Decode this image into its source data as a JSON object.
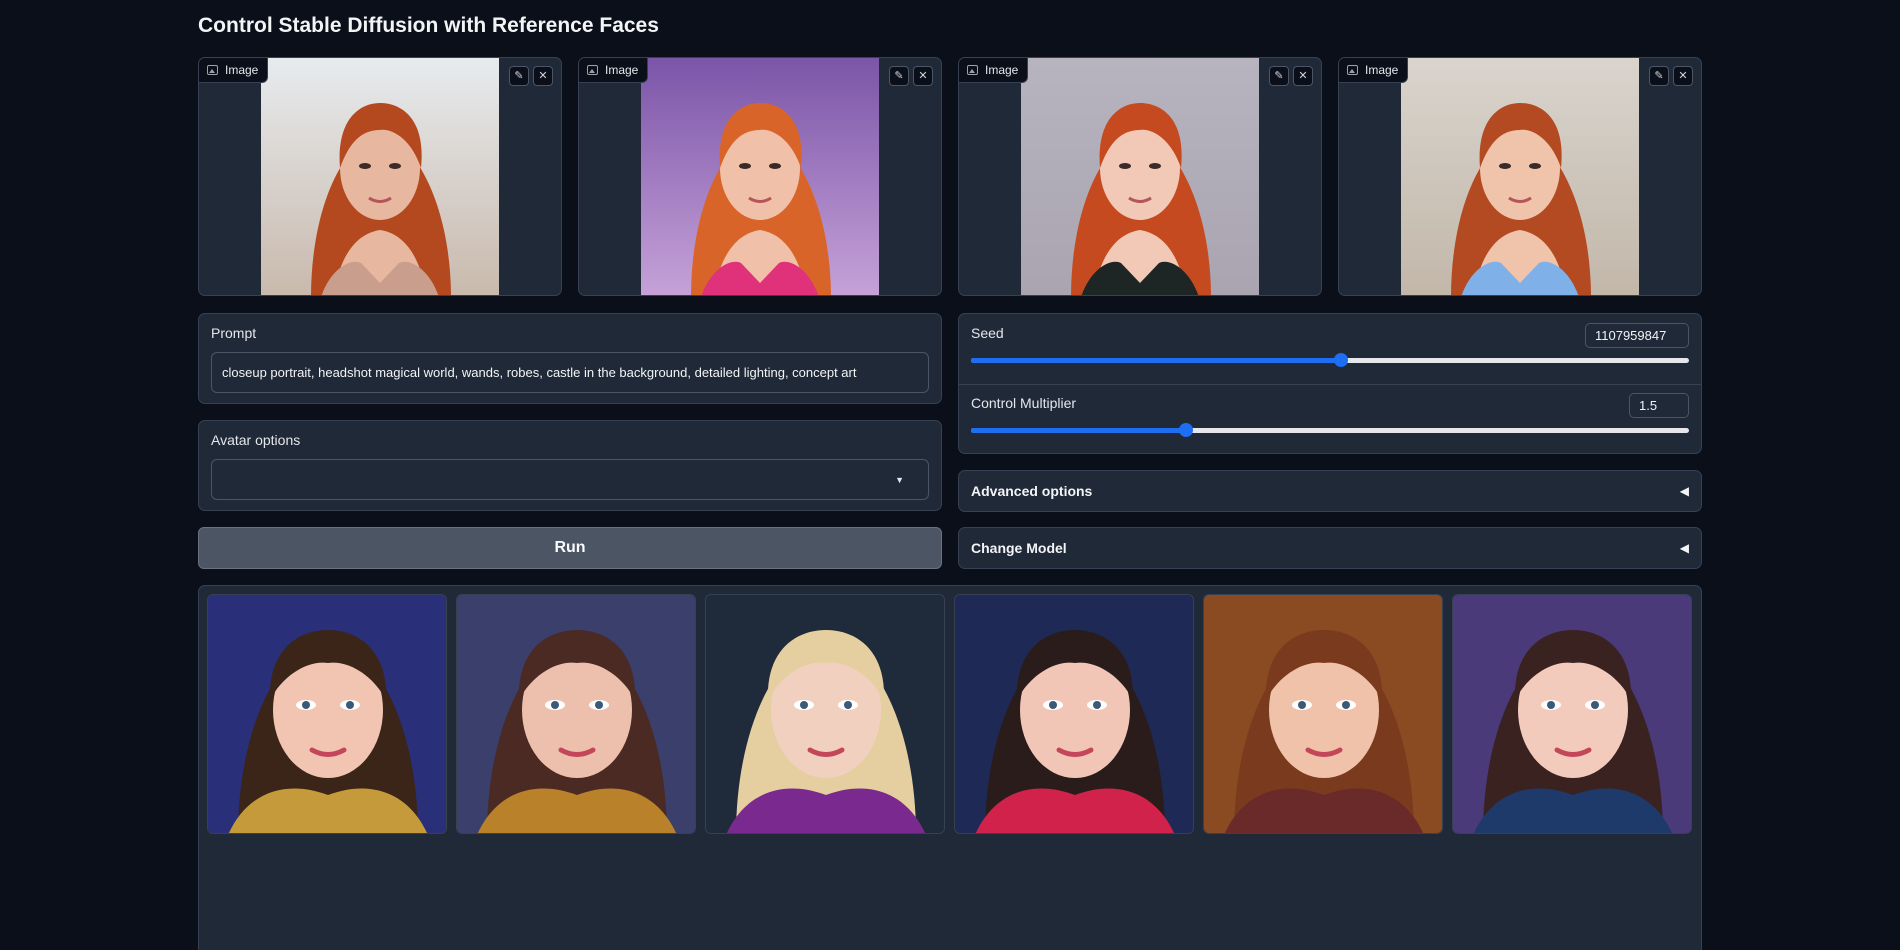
{
  "page_title": "Control Stable Diffusion with Reference Faces",
  "reference_images": [
    {
      "label": "Image",
      "skin": "#e7b7a0",
      "hair": "#b4491f",
      "bg_top": "#e7ebee",
      "bg_bottom": "#c9b9ac",
      "top": "#c99e8d"
    },
    {
      "label": "Image",
      "skin": "#f0c1a8",
      "hair": "#d9642a",
      "bg_top": "#7b55a8",
      "bg_bottom": "#c6a2d8",
      "top": "#e0327a"
    },
    {
      "label": "Image",
      "skin": "#f2c9b6",
      "hair": "#c54a1f",
      "bg_top": "#b7b4bf",
      "bg_bottom": "#a9a4b0",
      "top": "#1d2624"
    },
    {
      "label": "Image",
      "skin": "#f0c3ab",
      "hair": "#b34a22",
      "bg_top": "#d9d4cd",
      "bg_bottom": "#c2b7a9",
      "top": "#7fb1e8"
    }
  ],
  "prompt": {
    "label": "Prompt",
    "value": "closeup portrait, headshot magical world, wands, robes, castle in the background, detailed lighting, concept art"
  },
  "avatar_options": {
    "label": "Avatar options",
    "selected": ""
  },
  "run_button": {
    "label": "Run"
  },
  "seed": {
    "label": "Seed",
    "value": "1107959847",
    "fraction": 0.516
  },
  "control_multiplier": {
    "label": "Control Multiplier",
    "value": "1.5",
    "fraction": 0.3
  },
  "advanced_options": {
    "label": "Advanced options"
  },
  "change_model": {
    "label": "Change Model"
  },
  "gallery": [
    {
      "skin": "#f1c5b2",
      "hair": "#3b2418",
      "bg": "#2a2f7a",
      "robe": "#c49a3a"
    },
    {
      "skin": "#ecc0ad",
      "hair": "#4a2a22",
      "bg": "#3a3f6c",
      "robe": "#b9822a"
    },
    {
      "skin": "#f2d0bf",
      "hair": "#e5cfa0",
      "bg": "#1f2a3a",
      "robe": "#7a2a8e"
    },
    {
      "skin": "#f1c6b7",
      "hair": "#2a1c1a",
      "bg": "#1e2a55",
      "robe": "#d0224a"
    },
    {
      "skin": "#f0c2a9",
      "hair": "#7a3a1d",
      "bg": "#8a4a22",
      "robe": "#6a2a2a"
    },
    {
      "skin": "#f2cbbc",
      "hair": "#3a2220",
      "bg": "#4a3a7a",
      "robe": "#1e3a6a"
    }
  ]
}
